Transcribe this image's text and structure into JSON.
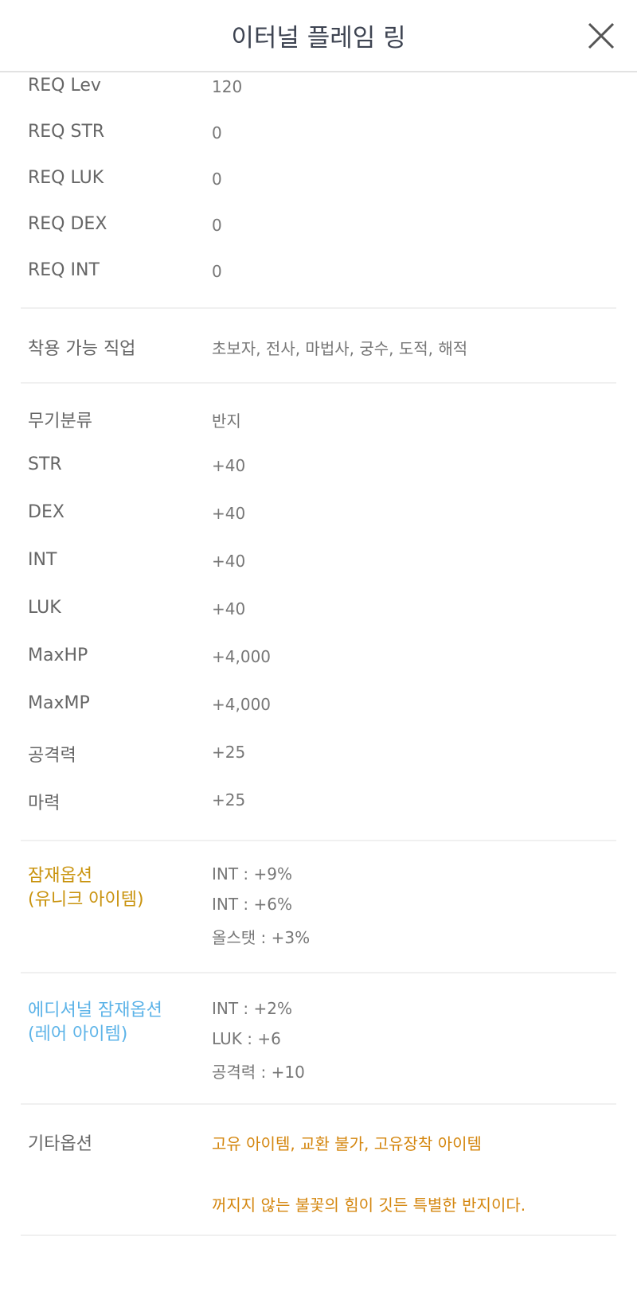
{
  "header": {
    "title": "이터널 플레임 링",
    "close_icon": "close-icon"
  },
  "requirements": [
    {
      "label": "REQ Lev",
      "value": "120"
    },
    {
      "label": "REQ STR",
      "value": "0"
    },
    {
      "label": "REQ LUK",
      "value": "0"
    },
    {
      "label": "REQ DEX",
      "value": "0"
    },
    {
      "label": "REQ INT",
      "value": "0"
    }
  ],
  "jobs": {
    "label": "착용 가능 직업",
    "value": "초보자, 전사, 마법사, 궁수, 도적, 해적"
  },
  "stats": [
    {
      "label": "무기분류",
      "value": "반지"
    },
    {
      "label": "STR",
      "value": "+40"
    },
    {
      "label": "DEX",
      "value": "+40"
    },
    {
      "label": "INT",
      "value": "+40"
    },
    {
      "label": "LUK",
      "value": "+40"
    },
    {
      "label": "MaxHP",
      "value": "+4,000"
    },
    {
      "label": "MaxMP",
      "value": "+4,000"
    },
    {
      "label": "공격력",
      "value": "+25"
    },
    {
      "label": "마력",
      "value": "+25"
    }
  ],
  "potential": {
    "label1": "잠재옵션",
    "label2": "(유니크 아이템)",
    "color": "#c9930e",
    "lines": [
      "INT : +9%",
      "INT : +6%",
      "올스탯 : +3%"
    ]
  },
  "additional": {
    "label1": "에디셔널 잠재옵션",
    "label2": "(레어 아이템)",
    "color": "#5cb3e8",
    "lines": [
      "INT : +2%",
      "LUK : +6",
      "공격력 : +10"
    ]
  },
  "etc": {
    "label": "기타옵션",
    "line1": "고유 아이템, 교환 불가, 고유장착 아이템",
    "line2": "꺼지지 않는 불꽃의 힘이 깃든 특별한 반지이다.",
    "color": "#d4860e"
  }
}
